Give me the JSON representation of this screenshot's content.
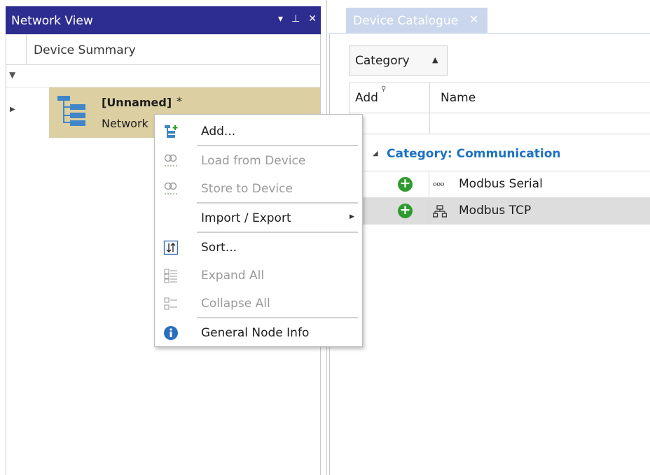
{
  "network_view": {
    "title": "Network View",
    "controls": {
      "dropdown": "▾",
      "pin": "⊥",
      "close": "✕"
    },
    "column_header": "Device Summary",
    "node": {
      "name": "[Unnamed]",
      "modified_marker": "*",
      "subtitle": "Network"
    }
  },
  "context_menu": {
    "items": [
      {
        "label": "Add...",
        "enabled": true,
        "icon": "add-node-icon"
      },
      {
        "label": "Load from Device",
        "enabled": false,
        "icon": "load-from-device-icon"
      },
      {
        "label": "Store to Device",
        "enabled": false,
        "icon": "store-to-device-icon"
      },
      {
        "label": "Import / Export",
        "enabled": true,
        "submenu": true
      },
      {
        "label": "Sort...",
        "enabled": true,
        "icon": "sort-icon"
      },
      {
        "label": "Expand All",
        "enabled": false,
        "icon": "expand-all-icon"
      },
      {
        "label": "Collapse All",
        "enabled": false,
        "icon": "collapse-all-icon"
      },
      {
        "label": "General Node Info",
        "enabled": true,
        "icon": "info-icon"
      }
    ]
  },
  "device_catalogue": {
    "tab_title": "Device Catalogue",
    "tab_close": "✕",
    "group_by": "Category",
    "columns": {
      "add": "Add",
      "name": "Name"
    },
    "category": "Category: Communication",
    "devices": [
      {
        "name": "Modbus Serial",
        "icon": "serial-icon"
      },
      {
        "name": "Modbus TCP",
        "icon": "network-icon"
      }
    ]
  },
  "colors": {
    "title_bar": "#2d2d8f",
    "node_highlight": "#dccfa2",
    "category_text": "#1c72c4",
    "add_button": "#2e9a2e",
    "tab_inactive": "#c9d6ec",
    "selected_row": "#dddddd"
  }
}
